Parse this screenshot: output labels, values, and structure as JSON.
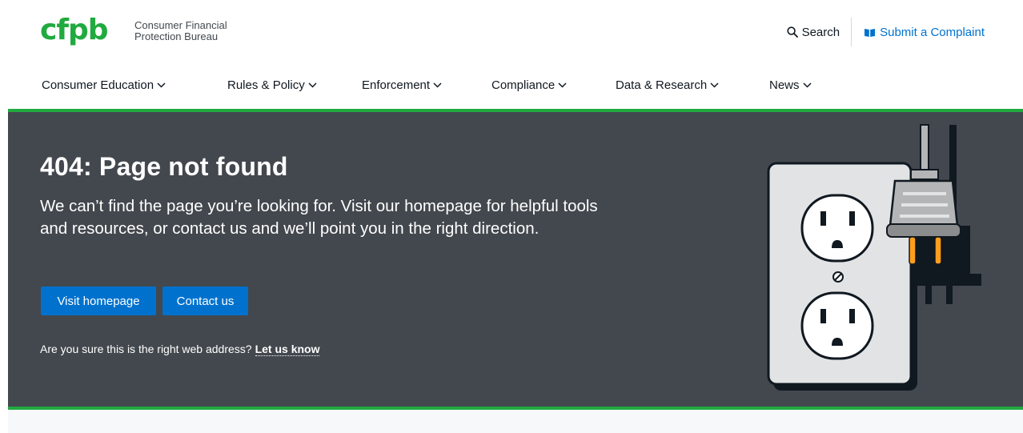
{
  "brand": {
    "logo_text": "cfpb",
    "name_line1": "Consumer Financial",
    "name_line2": "Protection Bureau",
    "green": "#20aa3f",
    "logo_green": "#20aa3f",
    "logo_light_green": "#addc91"
  },
  "utility_nav": {
    "search_label": "Search",
    "complaint_label": "Submit a Complaint"
  },
  "main_nav": {
    "items": [
      {
        "label": "Consumer Education"
      },
      {
        "label": "Rules & Policy"
      },
      {
        "label": "Enforcement"
      },
      {
        "label": "Compliance"
      },
      {
        "label": "Data & Research"
      },
      {
        "label": "News"
      }
    ]
  },
  "hero": {
    "title": "404: Page not found",
    "description": "We can’t find the page you’re looking for. Visit our homepage for helpful tools and resources, or contact us and we’ll point you in the right direction.",
    "primary_button": "Visit homepage",
    "secondary_button": "Contact us",
    "note_text": "Are you sure this is the right web address?",
    "note_link": "Let us know",
    "background": "#43484e",
    "button_color": "#0072ce"
  },
  "icons": {
    "search": "search-icon",
    "complaint": "complaint-book-icon",
    "chevron": "chevron-down-icon",
    "illustration": "outlet-plug-illustration"
  }
}
